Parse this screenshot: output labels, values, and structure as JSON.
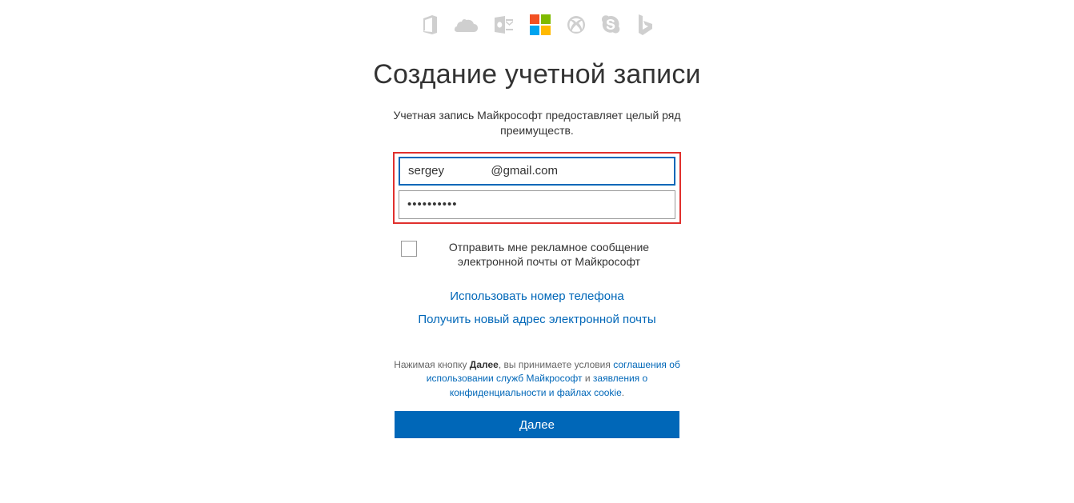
{
  "heading": "Создание учетной записи",
  "subtitle": "Учетная запись Майкрософт предоставляет целый ряд преимуществ.",
  "form": {
    "email_value": "sergey              @gmail.com",
    "password_value": "••••••••••"
  },
  "checkbox": {
    "label": "Отправить мне рекламное сообщение электронной почты от Майкрософт"
  },
  "links": {
    "use_phone": "Использовать номер телефона",
    "get_new_email": "Получить новый адрес электронной почты"
  },
  "legal": {
    "prefix": "Нажимая кнопку ",
    "bold": "Далее",
    "mid1": ", вы принимаете условия ",
    "terms_link": "соглашения об использовании служб Майкрософт",
    "mid2": " и ",
    "privacy_link": "заявления о конфиденциальности и файлах cookie",
    "suffix": "."
  },
  "next_button": "Далее",
  "icons": {
    "office": "office-icon",
    "onedrive": "onedrive-icon",
    "outlook": "outlook-icon",
    "microsoft": "microsoft-logo",
    "xbox": "xbox-icon",
    "skype": "skype-icon",
    "bing": "bing-icon"
  }
}
